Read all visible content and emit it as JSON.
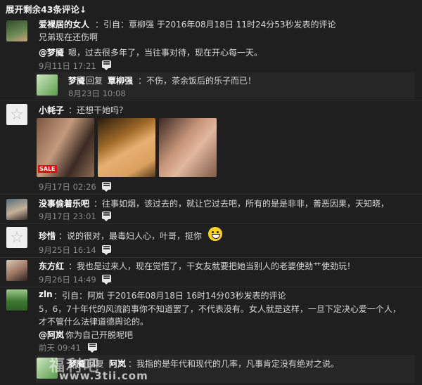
{
  "expand_label": "展开剩余43条评论↓",
  "comments": [
    {
      "name": "爱裸居的女人",
      "quote": "：引自：覃柳强 于2016年08月18日 11时24分53秒发表的评论",
      "line2": "兄弟现在还伤啊",
      "reply_to": "@梦魇",
      "reply_text": " 嗯，过去很多年了，当往事对待，现在开心每一天。",
      "time": "9月11日 17:21",
      "nested": {
        "name": "梦魇",
        "mid": " 回复 ",
        "target": "覃柳强",
        "text": " ：不伤，茶余饭后的乐子而已！",
        "time": "8月23日 10:08"
      }
    },
    {
      "name": "小耗子",
      "text": "：还想干她吗？",
      "time": "9月17日 02:26",
      "badge": "SALE"
    },
    {
      "name": "没事偷着乐吧",
      "text": "：往事如烟，该过去的，就让它过去吧，所有的是是非非，善恶因果，天知晓，",
      "time": "9月17日 23:01"
    },
    {
      "name": "珍惜",
      "text": "：说的很对，最毒妇人心，叶哥，挺你",
      "time": "9月25日 16:14"
    },
    {
      "name": "东方红",
      "text": "：我也是过来人，现在觉悟了，干女友就要把她当别人的老婆使劲艹使劲玩！",
      "time": "9月26日 14:49"
    },
    {
      "name": "zln",
      "quote": "：引自：阿岚 于2016年08月18日 16时14分03秒发表的评论",
      "line2": "5，6，7十年代的风流韵事你不知道罢了，不代表没有。女人就是这样，一旦下定决心爱一个人，",
      "line3": "才不管什么法律道德舆论的。",
      "reply_to": "@阿岚",
      "reply_text": " 你为自己开脱呢吧",
      "time": "前天 09:41",
      "nested": {
        "name": "梦魇",
        "mid": "回复 ",
        "target": "阿岚",
        "text": " ：我指的是年代和现代的几率，凡事肯定没有绝对之说。"
      }
    }
  ],
  "watermark": {
    "line1": "福利吧",
    "line2": "www.3tii.com"
  },
  "icons": {
    "reply": "reply-icon",
    "smiley": "smiley-emoji",
    "default_avatar": "star-icon"
  }
}
